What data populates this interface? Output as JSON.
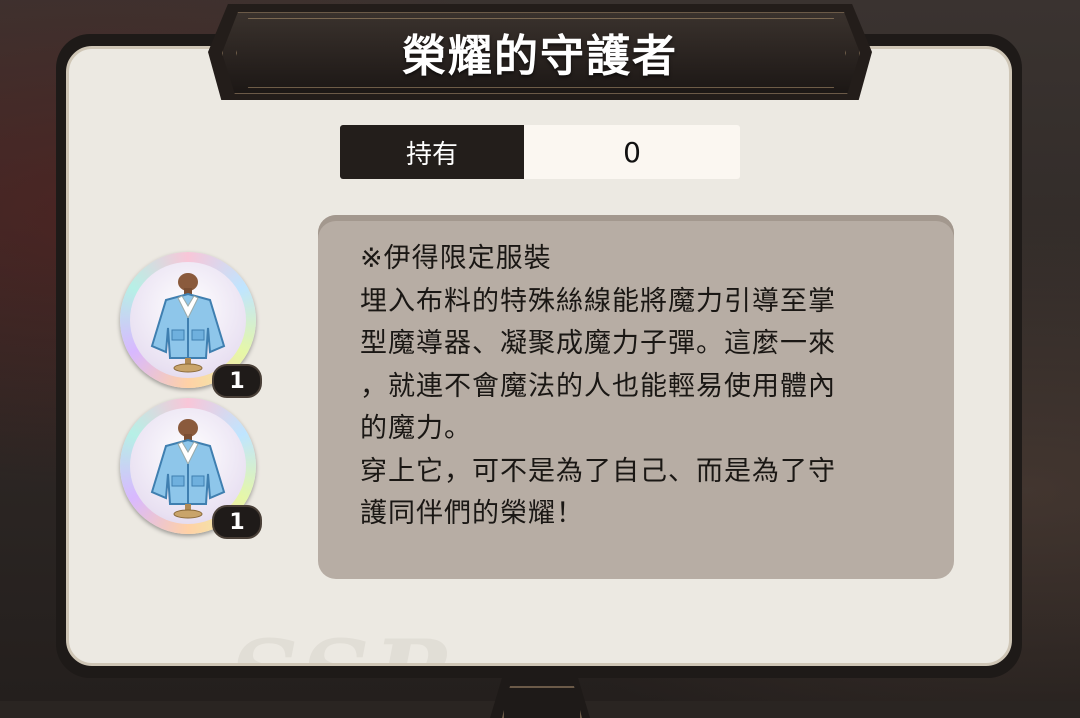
{
  "title": "榮耀的守護者",
  "ownership": {
    "label": "持有",
    "value": "0"
  },
  "description": {
    "text": "※伊得限定服裝\n埋入布料的特殊絲線能將魔力引導至掌\n型魔導器、凝聚成魔力子彈。這麼一來\n，就連不會魔法的人也能輕易使用體內\n的魔力。\n穿上它，可不是為了自己、而是為了守\n護同伴們的榮耀！"
  },
  "items": [
    {
      "icon": "jacket-costume-icon",
      "quantity": "1"
    },
    {
      "icon": "jacket-costume-icon",
      "quantity": "1"
    }
  ],
  "colors": {
    "panel": "#ece9e2",
    "title_plate": "#231d1a",
    "description_box": "#b7ada4"
  }
}
